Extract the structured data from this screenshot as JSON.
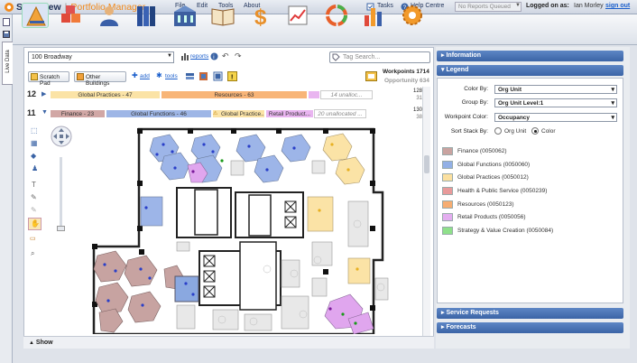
{
  "app": {
    "brand": "Serraview",
    "product": "Portfolio Manager"
  },
  "menu": [
    "File",
    "Edit",
    "Tools",
    "About"
  ],
  "header": {
    "tasks": "Tasks",
    "help": "Help Centre",
    "queue": "No Reports Queued",
    "logged_label": "Logged on as:",
    "user": "Ian Morley",
    "signout": "sign out"
  },
  "side_tab": "Live Data",
  "building": "100 Broadway",
  "reports": "reports",
  "tag_placeholder": "Tag Search...",
  "buttons": {
    "scratch": "Scratch Pad",
    "other": "Other Buildings",
    "add": "add",
    "tools": "tools"
  },
  "stats": {
    "workpoints": "Workpoints 1714",
    "opportunity": "Opportunity 634"
  },
  "stack": [
    {
      "floor": "12",
      "count_top": "128",
      "count_bottom": "31",
      "segments": [
        {
          "label": "Global Practices - 47",
          "color": "#fbe3a6",
          "width": 123
        },
        {
          "label": "Resources - 63",
          "color": "#f8b578",
          "width": 163
        },
        {
          "label": "",
          "color": "#e9b5f0",
          "width": 14
        },
        {
          "label": "14 unalloc...",
          "color": "#ffffff",
          "width": 58
        }
      ]
    },
    {
      "floor": "11",
      "count_top": "130",
      "count_bottom": "38",
      "segments": [
        {
          "label": "Finance - 23",
          "color": "#d1a7a5",
          "width": 62
        },
        {
          "label": "Global Functions - 46",
          "color": "#9eb6e6",
          "width": 118
        },
        {
          "label": "Global Practice...",
          "color": "#fbe3a6",
          "width": 59
        },
        {
          "label": "Retail Product...",
          "color": "#e9b5f0",
          "width": 54
        },
        {
          "label": "20 unallocated ...",
          "color": "#ffffff",
          "width": 58
        }
      ]
    }
  ],
  "show": "Show",
  "panels": {
    "information": "Information",
    "legend": "Legend",
    "service": "Service Requests",
    "forecasts": "Forecasts"
  },
  "legend": {
    "color_by_label": "Color By:",
    "color_by": "Org Unit",
    "group_by_label": "Group By:",
    "group_by": "Org Unit Level:1",
    "wp_color_label": "Workpoint Color:",
    "wp_color": "Occupancy",
    "sort_label": "Sort Stack By:",
    "sort_opt1": "Org Unit",
    "sort_opt2": "Color",
    "items": [
      {
        "label": "Finance (0050062)",
        "color": "#c9a3a0"
      },
      {
        "label": "Global Functions (0050060)",
        "color": "#92b0e6"
      },
      {
        "label": "Global Practices (0050012)",
        "color": "#fbe0a0"
      },
      {
        "label": "Health & Public Service (0050239)",
        "color": "#e89a9a"
      },
      {
        "label": "Resources (0050123)",
        "color": "#f6ad72"
      },
      {
        "label": "Retail Products (0050056)",
        "color": "#e4aef0"
      },
      {
        "label": "Strategy & Value Creation (0050084)",
        "color": "#8fe08a"
      }
    ]
  }
}
